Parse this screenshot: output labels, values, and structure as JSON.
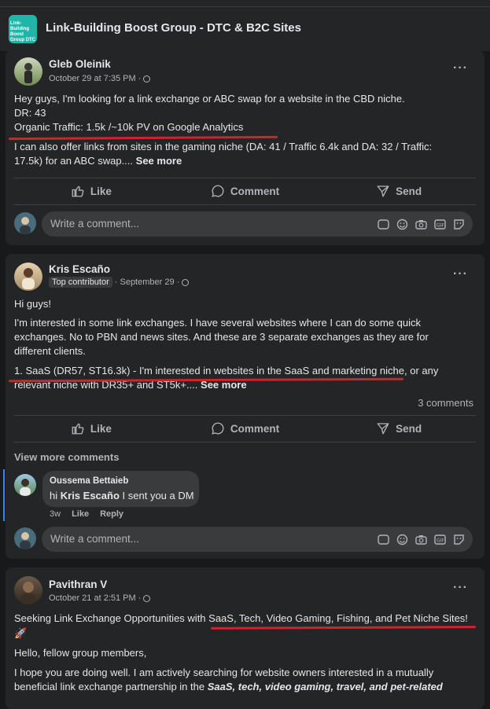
{
  "group": {
    "title": "Link-Building Boost Group - DTC & B2C Sites",
    "thumb_text": "Link-Building Boost Group DTC & B2C Sites"
  },
  "actions": {
    "like": "Like",
    "comment": "Comment",
    "send": "Send"
  },
  "composer": {
    "placeholder": "Write a comment..."
  },
  "post1": {
    "author": "Gleb Oleinik",
    "time": "October 29 at 7:35 PM ·",
    "line1": "Hey guys, I'm looking for a link exchange or ABC swap for a website in the CBD niche.",
    "line2": "DR: 43",
    "line3": "Organic Traffic: 1.5k /~10k PV on Google Analytics",
    "line4": "I can also offer links from sites in the gaming niche (DA: 41 / Traffic 6.4k and DA: 32 / Traffic:",
    "line5": "17.5k) for an ABC swap....",
    "see_more": "See more"
  },
  "post2": {
    "author": "Kris Escaño",
    "badge": "Top contributor",
    "time": "· September 29 ·",
    "line1": "Hi guys!",
    "line2": "I'm interested in some link exchanges. I have several websites where I can do some quick",
    "line3": "exchanges. No to PBN and news sites. And these are 3 separate exchanges as they are for",
    "line4": "different clients.",
    "line5": "1. SaaS (DR57, ST16.3k) - I'm interested in websites in the SaaS and marketing niche, or any",
    "line6": "relevant niche with DR35+ and ST5k+....",
    "see_more": "See more",
    "comments_count": "3 comments",
    "view_more": "View more comments",
    "reply": {
      "author": "Oussema Bettaieb",
      "prefix": "hi",
      "mention": "Kris Escaño",
      "text": "I sent you a DM",
      "age": "3w",
      "like": "Like",
      "reply": "Reply"
    }
  },
  "post3": {
    "author": "Pavithran V",
    "time": "October 21 at 2:51 PM ·",
    "line1": "Seeking Link Exchange Opportunities with SaaS, Tech, Video Gaming, Fishing, and Pet Niche Sites!",
    "line2": "🚀",
    "line3": "Hello, fellow group members,",
    "line4": "I hope you are doing well. I am actively searching for website owners interested in a mutually",
    "line5_a": "beneficial link exchange partnership in the",
    "line5_b": "SaaS, tech, video gaming, travel, and pet-related"
  },
  "colors": {
    "bg": "#18191a",
    "card": "#242526",
    "underline": "#d2232a",
    "muted": "#b0b3b8"
  }
}
